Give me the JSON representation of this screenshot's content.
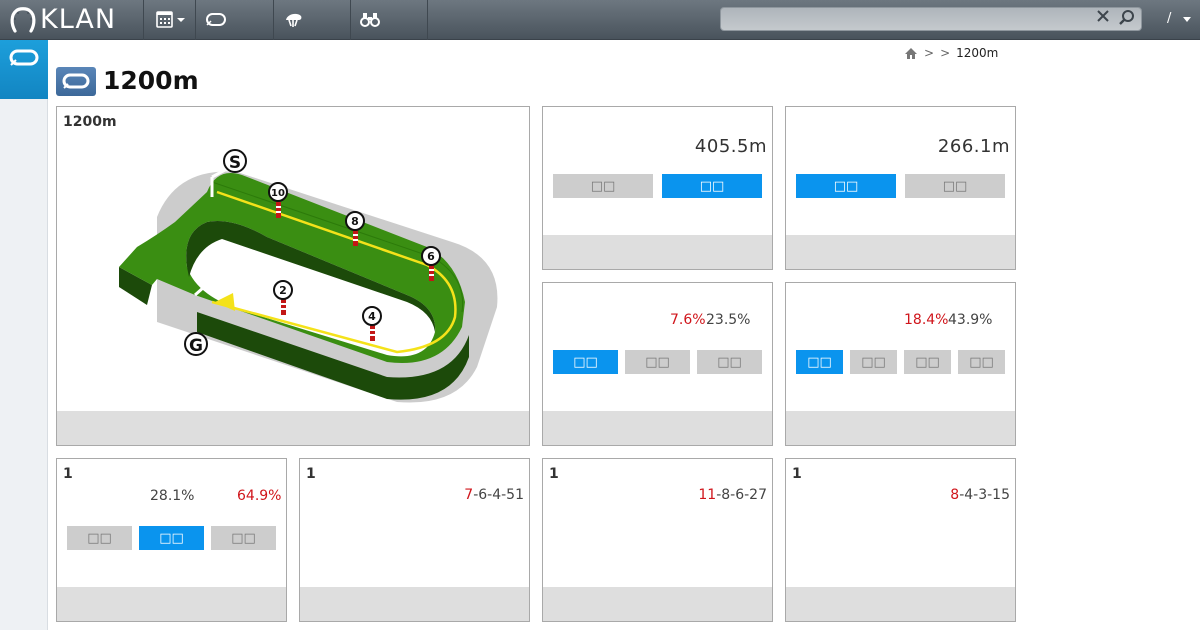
{
  "header": {
    "logo_text": "KLAN",
    "search": {
      "value": "",
      "placeholder": ""
    },
    "user_menu_label": "/",
    "nav": [
      "calendar-icon",
      "course-icon",
      "jockey-icon",
      "binoculars-icon"
    ]
  },
  "breadcrumb": {
    "sep1": ">",
    "sep2": ">",
    "current": "1200m"
  },
  "page": {
    "title": "1200m"
  },
  "course_panel": {
    "label": "1200m",
    "markers": [
      "S",
      "G",
      "10",
      "8",
      "6",
      "4",
      "2"
    ]
  },
  "stat_panels": [
    {
      "value": "405.5m",
      "buttons": [
        {
          "label": "□□",
          "active": false
        },
        {
          "label": "□□",
          "active": true
        }
      ]
    },
    {
      "value": "266.1m",
      "buttons": [
        {
          "label": "□□",
          "active": true
        },
        {
          "label": "□□",
          "active": false
        }
      ]
    },
    {
      "pct_red": "7.6%",
      "pct": "23.5%",
      "buttons": [
        {
          "label": "□□",
          "active": true
        },
        {
          "label": "□□",
          "active": false
        },
        {
          "label": "□□",
          "active": false
        }
      ]
    },
    {
      "pct_red": "18.4%",
      "pct": "43.9%",
      "buttons": [
        {
          "label": "□□",
          "active": true
        },
        {
          "label": "□□",
          "active": false
        },
        {
          "label": "□□",
          "active": false
        },
        {
          "label": "□□",
          "active": false
        }
      ]
    }
  ],
  "bottom_panels": [
    {
      "label": "1",
      "pct": "28.1%",
      "pct_red": "64.9%",
      "buttons": [
        {
          "label": "□□",
          "active": false
        },
        {
          "label": "□□",
          "active": true
        },
        {
          "label": "□□",
          "active": false
        }
      ]
    },
    {
      "label": "1",
      "seq_red": "7",
      "seq": "-6-4-51"
    },
    {
      "label": "1",
      "seq_red": "11",
      "seq": "-8-6-27"
    },
    {
      "label": "1",
      "seq_red": "8",
      "seq": "-4-3-15"
    }
  ],
  "colors": {
    "accent": "#0a94ee",
    "highlight": "#d0151b",
    "track": "#3a8e12"
  }
}
